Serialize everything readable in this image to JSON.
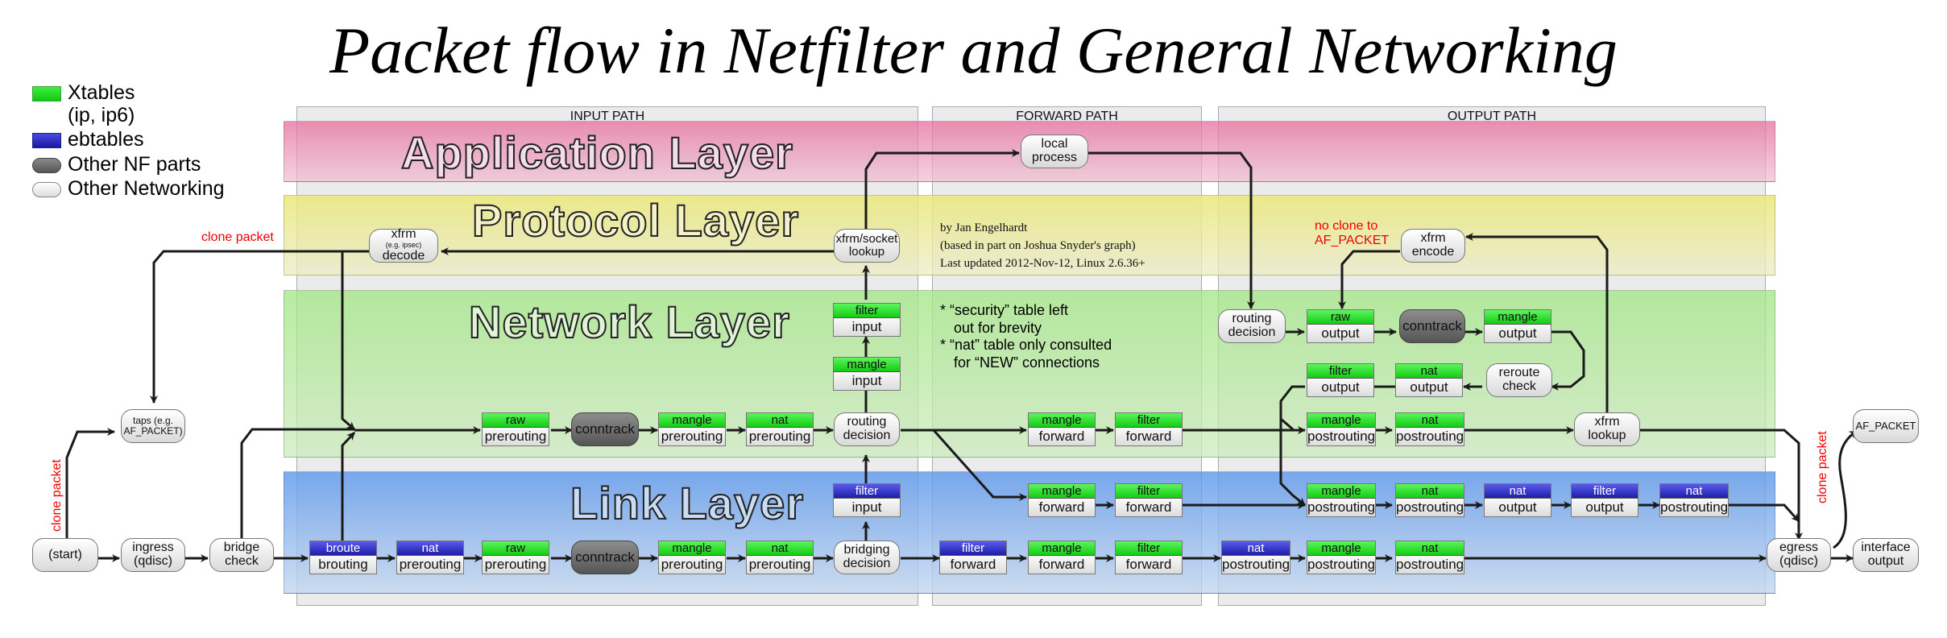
{
  "title": "Packet flow in Netfilter and General Networking",
  "legend": [
    {
      "label": "Xtables",
      "sub": "(ip, ip6)",
      "swatch": "green"
    },
    {
      "label": "ebtables",
      "swatch": "blue"
    },
    {
      "label": "Other NF parts",
      "swatch": "dark"
    },
    {
      "label": "Other Networking",
      "swatch": "light"
    }
  ],
  "paths": {
    "input": "INPUT PATH",
    "forward": "FORWARD PATH",
    "output": "OUTPUT PATH"
  },
  "layers": {
    "application": "Application Layer",
    "protocol": "Protocol Layer",
    "network": "Network Layer",
    "link": "Link Layer"
  },
  "credits": {
    "line1": "by Jan Engelhardt",
    "line2": "(based in part on Joshua Snyder's graph)",
    "line3": "Last updated 2012-Nov-12, Linux 2.6.36+"
  },
  "notes": {
    "line1": "* “security” table left",
    "line2": "out for brevity",
    "line3": "* “nat” table only consulted",
    "line4": "for “NEW” connections"
  },
  "annotations": {
    "clone_packet_top": "clone packet",
    "clone_packet_left": "clone packet",
    "clone_packet_right": "clone packet",
    "no_clone_1": "no clone to",
    "no_clone_2": "AF_PACKET"
  },
  "colors": {
    "xtables": "#1fd61f",
    "ebtables": "#2323b0",
    "nf_parts": "#6e6e6e",
    "networking": "#e8e8e8",
    "annotation": "#ee0000"
  },
  "nodes": {
    "start": "(start)",
    "ingress_1": "ingress",
    "ingress_2": "(qdisc)",
    "bridge_1": "bridge",
    "bridge_2": "check",
    "taps_1": "taps (e.g.",
    "taps_2": "AF_PACKET)",
    "xfrm_decode_1": "xfrm",
    "xfrm_decode_small": "(e.g. ipsec)",
    "xfrm_decode_2": "decode",
    "xfrm_socket_1": "xfrm/socket",
    "xfrm_socket_2": "lookup",
    "local_1": "local",
    "local_2": "process",
    "routing_1": "routing",
    "routing_2": "decision",
    "bridging_1": "bridging",
    "bridging_2": "decision",
    "conntrack": "conntrack",
    "xfrm_encode_1": "xfrm",
    "xfrm_encode_2": "encode",
    "reroute_1": "reroute",
    "reroute_2": "check",
    "xfrm_lookup_1": "xfrm",
    "xfrm_lookup_2": "lookup",
    "egress_1": "egress",
    "egress_2": "(qdisc)",
    "iface_1": "interface",
    "iface_2": "output",
    "af_packet": "AF_PACKET"
  },
  "hooks": [
    {
      "id": "n-raw-pre",
      "table": "raw",
      "chain": "prerouting",
      "kind": "g"
    },
    {
      "id": "n-mangle-pre",
      "table": "mangle",
      "chain": "prerouting",
      "kind": "g"
    },
    {
      "id": "n-nat-pre",
      "table": "nat",
      "chain": "prerouting",
      "kind": "g"
    },
    {
      "id": "n-mangle-in",
      "table": "mangle",
      "chain": "input",
      "kind": "g"
    },
    {
      "id": "n-filter-in",
      "table": "filter",
      "chain": "input",
      "kind": "g"
    },
    {
      "id": "n-mangle-fwd",
      "table": "mangle",
      "chain": "forward",
      "kind": "g"
    },
    {
      "id": "n-filter-fwd",
      "table": "filter",
      "chain": "forward",
      "kind": "g"
    },
    {
      "id": "n-raw-out",
      "table": "raw",
      "chain": "output",
      "kind": "g"
    },
    {
      "id": "n-mangle-out",
      "table": "mangle",
      "chain": "output",
      "kind": "g"
    },
    {
      "id": "n-filter-out",
      "table": "filter",
      "chain": "output",
      "kind": "g"
    },
    {
      "id": "n-nat-out",
      "table": "nat",
      "chain": "output",
      "kind": "g"
    },
    {
      "id": "n-mangle-post",
      "table": "mangle",
      "chain": "postrouting",
      "kind": "g"
    },
    {
      "id": "n-nat-post",
      "table": "nat",
      "chain": "postrouting",
      "kind": "g"
    },
    {
      "id": "l-broute",
      "table": "broute",
      "chain": "brouting",
      "kind": "b"
    },
    {
      "id": "l-nat-pre-eb",
      "table": "nat",
      "chain": "prerouting",
      "kind": "b"
    },
    {
      "id": "l-raw-pre",
      "table": "raw",
      "chain": "prerouting",
      "kind": "g"
    },
    {
      "id": "l-mangle-pre",
      "table": "mangle",
      "chain": "prerouting",
      "kind": "g"
    },
    {
      "id": "l-nat-pre",
      "table": "nat",
      "chain": "prerouting",
      "kind": "g"
    },
    {
      "id": "l-filter-in-eb",
      "table": "filter",
      "chain": "input",
      "kind": "b"
    },
    {
      "id": "l-mangle-fwd-a",
      "table": "mangle",
      "chain": "forward",
      "kind": "g"
    },
    {
      "id": "l-filter-fwd-a",
      "table": "filter",
      "chain": "forward",
      "kind": "g"
    },
    {
      "id": "l-filter-fwd-eb",
      "table": "filter",
      "chain": "forward",
      "kind": "b"
    },
    {
      "id": "l-mangle-fwd-b",
      "table": "mangle",
      "chain": "forward",
      "kind": "g"
    },
    {
      "id": "l-filter-fwd-b",
      "table": "filter",
      "chain": "forward",
      "kind": "g"
    },
    {
      "id": "l-mangle-post-a",
      "table": "mangle",
      "chain": "postrouting",
      "kind": "g"
    },
    {
      "id": "l-nat-post-a",
      "table": "nat",
      "chain": "postrouting",
      "kind": "g"
    },
    {
      "id": "l-nat-out-eb",
      "table": "nat",
      "chain": "output",
      "kind": "b"
    },
    {
      "id": "l-filter-out-eb",
      "table": "filter",
      "chain": "output",
      "kind": "b"
    },
    {
      "id": "l-nat-post-eb-a",
      "table": "nat",
      "chain": "postrouting",
      "kind": "b"
    },
    {
      "id": "l-nat-post-eb-b",
      "table": "nat",
      "chain": "postrouting",
      "kind": "b"
    },
    {
      "id": "l-mangle-post-b",
      "table": "mangle",
      "chain": "postrouting",
      "kind": "g"
    },
    {
      "id": "l-nat-post-b",
      "table": "nat",
      "chain": "postrouting",
      "kind": "g"
    }
  ]
}
